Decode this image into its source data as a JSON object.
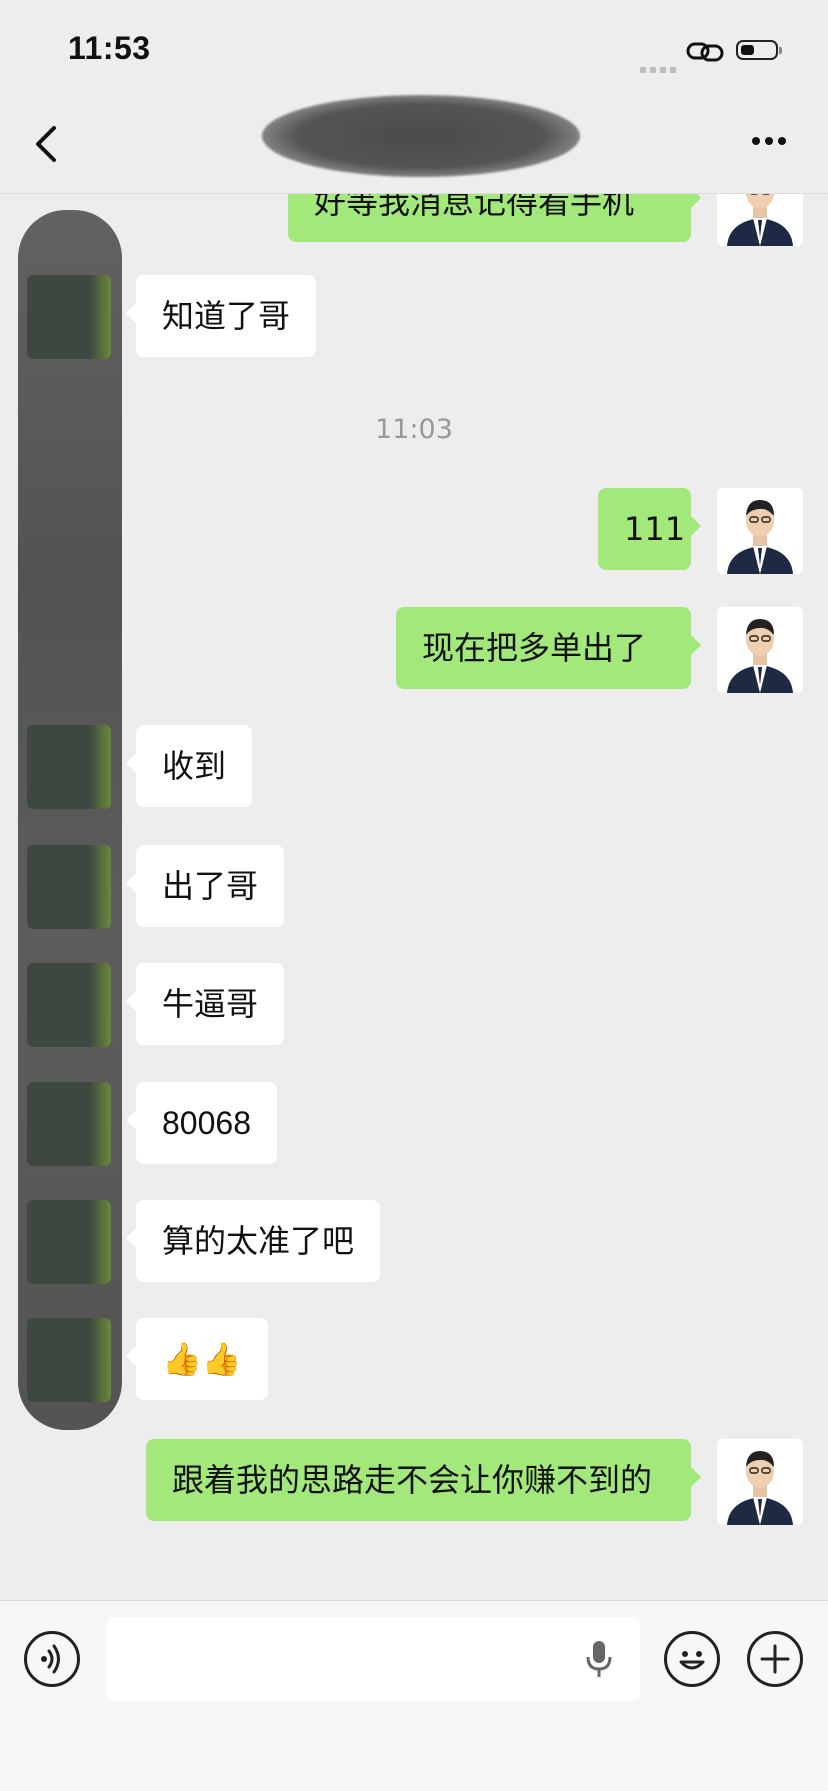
{
  "status_bar": {
    "time": "11:53"
  },
  "nav": {
    "title": "[redacted]"
  },
  "messages": [
    {
      "side": "out",
      "text": "好等我消息记得看手机"
    },
    {
      "side": "in",
      "text": "知道了哥"
    },
    {
      "side": "time",
      "text": "11:03"
    },
    {
      "side": "out",
      "text": "111"
    },
    {
      "side": "out",
      "text": "现在把多单出了"
    },
    {
      "side": "in",
      "text": "收到"
    },
    {
      "side": "in",
      "text": "出了哥"
    },
    {
      "side": "in",
      "text": "牛逼哥"
    },
    {
      "side": "in",
      "text": "80068"
    },
    {
      "side": "in",
      "text": "算的太准了吧"
    },
    {
      "side": "in",
      "text": "👍👍"
    },
    {
      "side": "out",
      "text": "跟着我的思路走不会让你赚不到的"
    }
  ],
  "input": {
    "placeholder": ""
  },
  "colors": {
    "out_bubble": "#a3e87b",
    "in_bubble": "#ffffff",
    "background": "#ededed"
  },
  "icons": [
    "back-icon",
    "more-icon",
    "voice-icon",
    "microphone-icon",
    "emoji-icon",
    "plus-icon"
  ]
}
